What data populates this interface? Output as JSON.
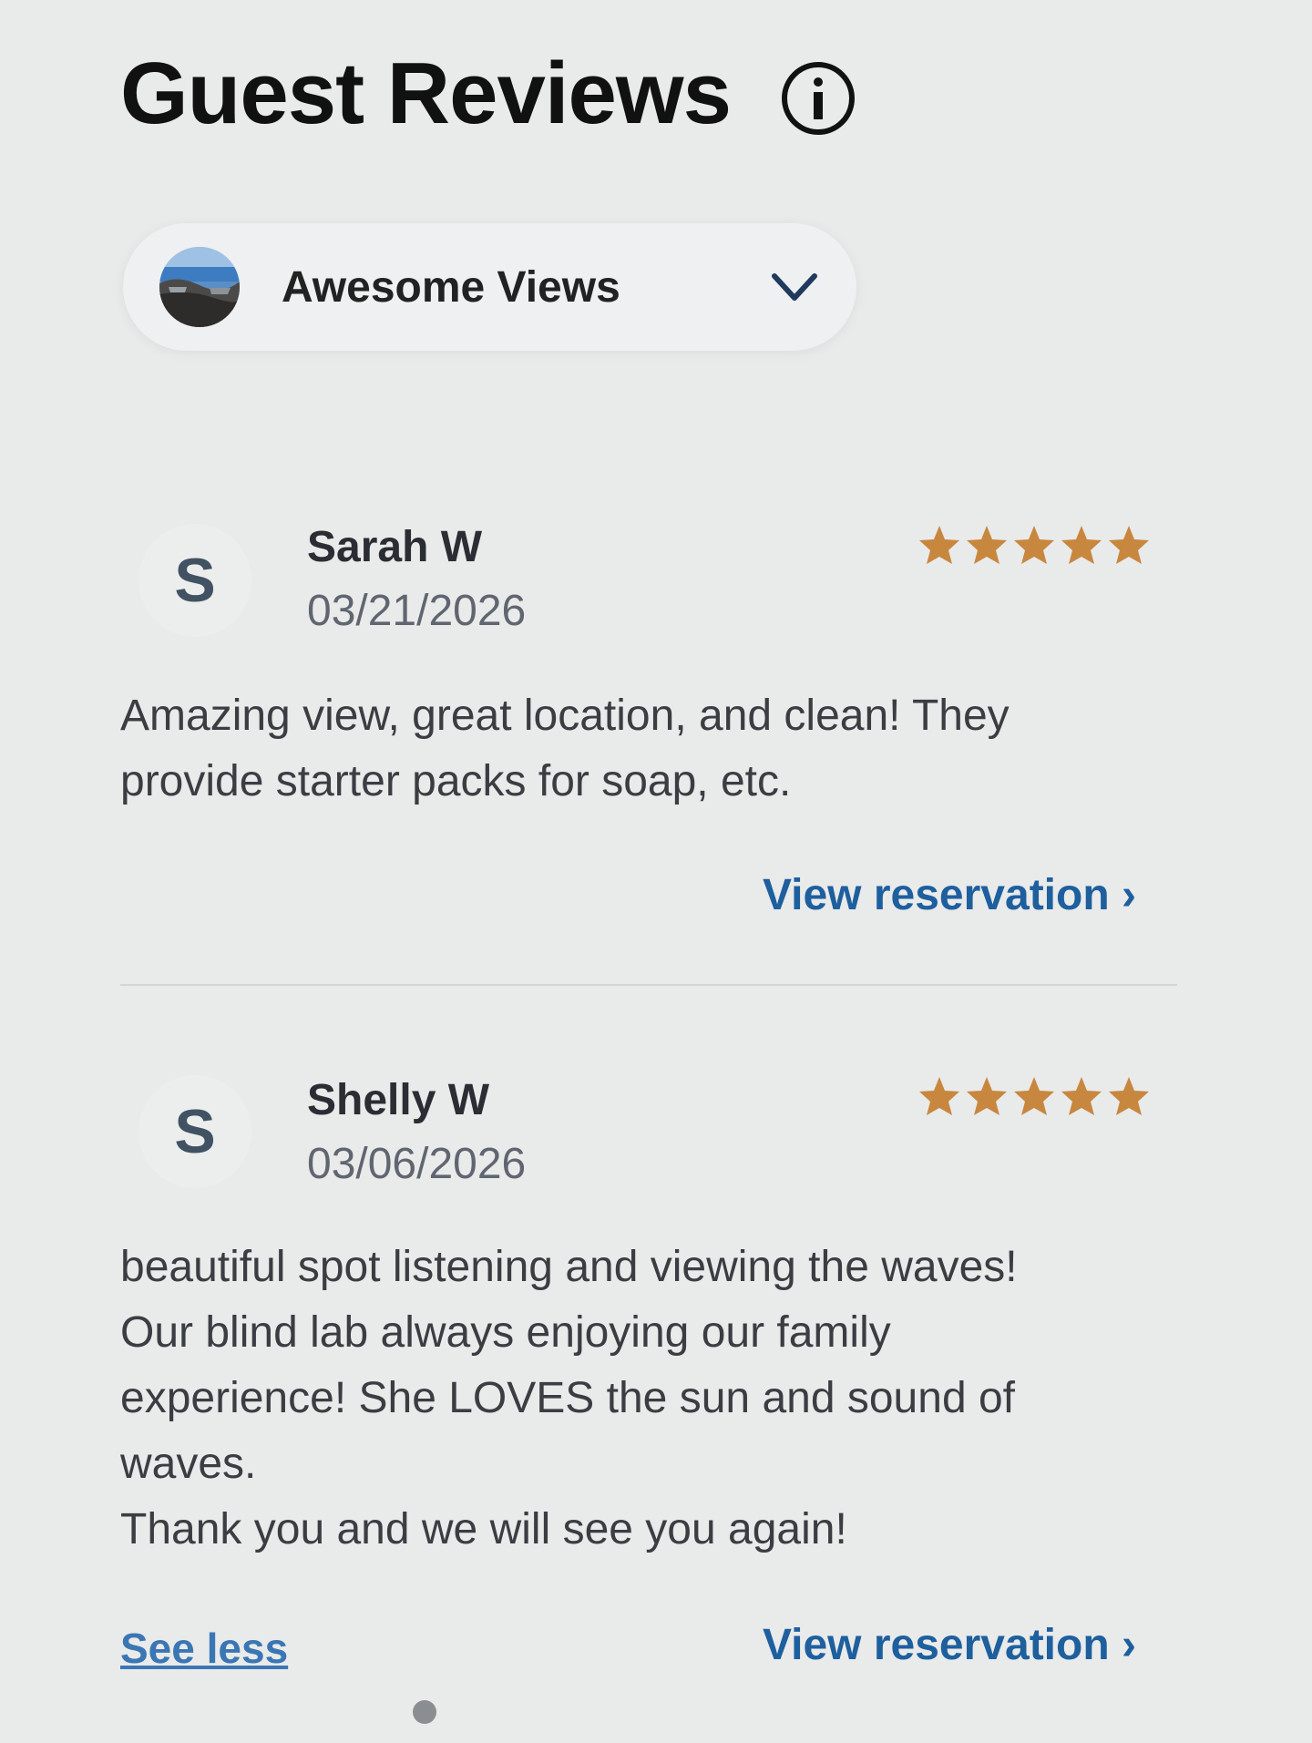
{
  "header": {
    "title": "Guest Reviews",
    "info_icon": "info-circle-icon"
  },
  "filter": {
    "label": "Awesome Views",
    "icon": "chevron-down-icon"
  },
  "reviews": [
    {
      "initial": "S",
      "name": "Sarah W",
      "date": "03/21/2026",
      "rating": 5,
      "body_lines": [
        "Amazing view, great location, and clean! They",
        "provide starter packs for soap, etc."
      ],
      "view_reservation": "View reservation ›"
    },
    {
      "initial": "S",
      "name": "Shelly W",
      "date": "03/06/2026",
      "rating": 5,
      "body_lines": [
        "beautiful spot listening and viewing the waves!",
        "Our blind lab always enjoying our family",
        "experience!  She LOVES the sun and sound of",
        "waves.",
        "Thank you and we will see you again!"
      ],
      "see_less": "See less",
      "view_reservation": "View reservation ›"
    }
  ],
  "colors": {
    "star": "#c8873f",
    "link": "#1e5f9e",
    "avatar_letter": "#415263"
  }
}
